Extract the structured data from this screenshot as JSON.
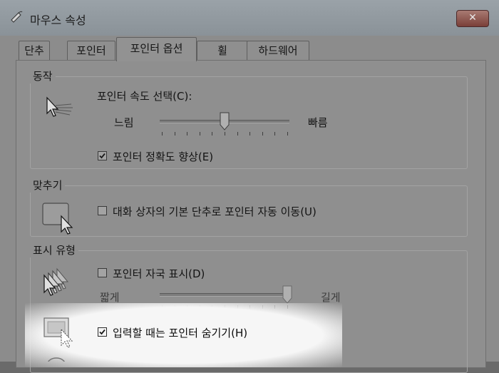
{
  "window": {
    "title": "마우스 속성",
    "close_label": "✕"
  },
  "tabs": [
    {
      "label": "단추",
      "active": false
    },
    {
      "label": "포인터",
      "active": false
    },
    {
      "label": "포인터 옵션",
      "active": true
    },
    {
      "label": "휠",
      "active": false
    },
    {
      "label": "하드웨어",
      "active": false
    }
  ],
  "motion": {
    "group_label": "동작",
    "speed_label": "포인터 속도 선택(C):",
    "slow_label": "느림",
    "fast_label": "빠름",
    "speed_value": 0.5,
    "precision_label": "포인터 정확도 향상(E)",
    "precision_checked": true
  },
  "snap": {
    "group_label": "맞추기",
    "snap_label": "대화 상자의 기본 단추로 포인터 자동 이동(U)",
    "snap_checked": false
  },
  "visibility": {
    "group_label": "표시 유형",
    "trails_label": "포인터 자국 표시(D)",
    "trails_checked": false,
    "short_label": "짧게",
    "long_label": "길게",
    "trail_value": 1.0,
    "hide_label": "입력할 때는 포인터 숨기기(H)",
    "hide_checked": true
  },
  "icons": [
    "mouse-icon",
    "pointer-speed-icon",
    "snap-to-icon",
    "pointer-trails-icon",
    "hide-pointer-icon"
  ]
}
